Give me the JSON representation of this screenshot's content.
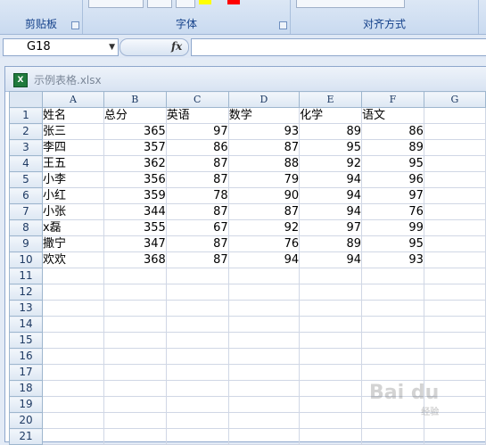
{
  "ribbon": {
    "groups": [
      {
        "label": "剪贴板"
      },
      {
        "label": "字体"
      },
      {
        "label": "对齐方式"
      }
    ]
  },
  "formula_bar": {
    "name_box": "G18",
    "fx_label": "fx",
    "formula": ""
  },
  "workbook": {
    "icon_label": "X",
    "title": "示例表格.xlsx"
  },
  "sheet": {
    "columns": [
      "A",
      "B",
      "C",
      "D",
      "E",
      "F",
      "G"
    ],
    "row_numbers": [
      "1",
      "2",
      "3",
      "4",
      "5",
      "6",
      "7",
      "8",
      "9",
      "10",
      "11",
      "12",
      "13",
      "14",
      "15",
      "16",
      "17",
      "18",
      "19",
      "20",
      "21"
    ],
    "headers": [
      "姓名",
      "总分",
      "英语",
      "数学",
      "化学",
      "语文"
    ],
    "rows": [
      [
        "张三",
        "365",
        "97",
        "93",
        "89",
        "86"
      ],
      [
        "李四",
        "357",
        "86",
        "87",
        "95",
        "89"
      ],
      [
        "王五",
        "362",
        "87",
        "88",
        "92",
        "95"
      ],
      [
        "小李",
        "356",
        "87",
        "79",
        "94",
        "96"
      ],
      [
        "小红",
        "359",
        "78",
        "90",
        "94",
        "97"
      ],
      [
        "小张",
        "344",
        "87",
        "87",
        "94",
        "76"
      ],
      [
        "x磊",
        "355",
        "67",
        "92",
        "97",
        "99"
      ],
      [
        "撒宁",
        "347",
        "87",
        "76",
        "89",
        "95"
      ],
      [
        "欢欢",
        "368",
        "87",
        "94",
        "94",
        "93"
      ]
    ]
  },
  "watermark": {
    "text": "Bai du",
    "sub": "经验"
  }
}
